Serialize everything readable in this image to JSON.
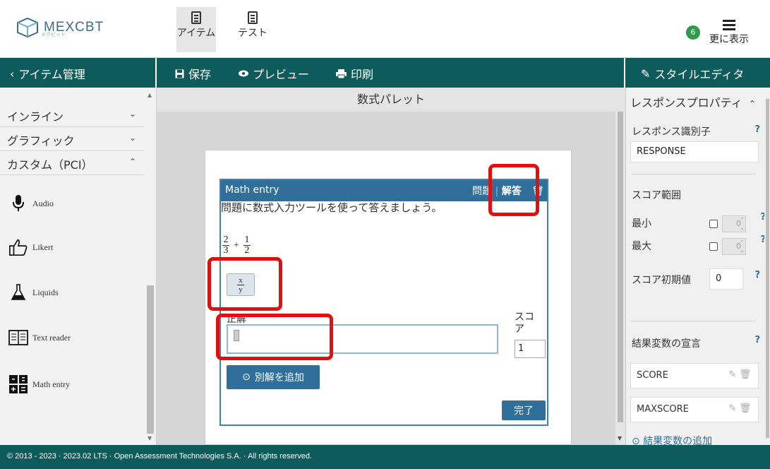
{
  "topbar": {
    "logo_text": "MEXCBT",
    "logo_sub": "メクビット",
    "nav": [
      {
        "label": "アイテム",
        "active": true
      },
      {
        "label": "テスト",
        "active": false
      }
    ],
    "badge_count": "6",
    "more_label": "更に表示"
  },
  "toolbar": {
    "back_label": "アイテム管理",
    "save_label": "保存",
    "preview_label": "プレビュー",
    "print_label": "印刷",
    "style_editor_label": "スタイルエディタ"
  },
  "left_panel": {
    "sections": [
      {
        "label": "インライン",
        "expanded": false
      },
      {
        "label": "グラフィック",
        "expanded": false
      },
      {
        "label": "カスタム（PCI）",
        "expanded": true
      }
    ],
    "pci_items": [
      {
        "label": "Audio",
        "icon": "microphone-icon"
      },
      {
        "label": "Likert",
        "icon": "thumbs-up-icon"
      },
      {
        "label": "Liquids",
        "icon": "flask-icon"
      },
      {
        "label": "Text reader",
        "icon": "text-reader-icon"
      },
      {
        "label": "Math entry",
        "icon": "math-entry-icon"
      }
    ]
  },
  "center": {
    "palette_title": "数式パレット",
    "math_entry": {
      "header": "Math entry",
      "tab_question": "問題",
      "tab_answer": "解答",
      "prompt": "問題に数式入力ツールを使って答えましょう。",
      "expr": {
        "n1": "2",
        "d1": "3",
        "op": "+",
        "n2": "1",
        "d2": "2"
      },
      "tool_num": "x",
      "tool_den": "y",
      "answer_label": "正解",
      "score_label": "スコア",
      "score_value": "1",
      "add_answer_label": "別解を追加",
      "done_label": "完了"
    }
  },
  "right_panel": {
    "title": "レスポンスプロパティ",
    "response_id_label": "レスポンス識別子",
    "response_id_value": "RESPONSE",
    "score_range_label": "スコア範囲",
    "min_label": "最小",
    "max_label": "最大",
    "min_value": "0",
    "max_value": "0",
    "score_default_label": "スコア初期値",
    "score_default_value": "0",
    "outcome_label": "結果変数の宣言",
    "outcomes": [
      "SCORE",
      "MAXSCORE"
    ],
    "add_outcome_label": "結果変数の追加",
    "help": "?"
  },
  "footer": {
    "text": "© 2013 - 2023 · 2023.02 LTS · Open Assessment Technologies S.A. · All rights reserved."
  },
  "colors": {
    "teal": "#0d5b5b",
    "blue": "#2f6f9a",
    "highlight": "#e01010"
  }
}
